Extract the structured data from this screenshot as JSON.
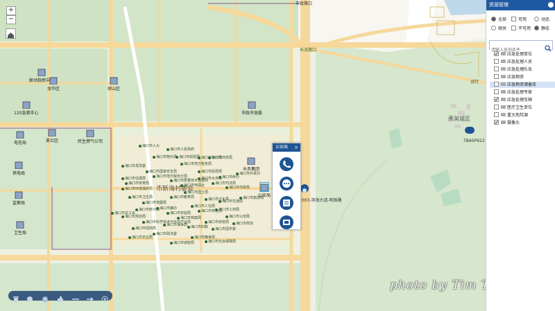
{
  "map": {
    "zoom_in": "+",
    "zoom_out": "−",
    "top_label": "市政路口",
    "road_label_top": "长流路口",
    "popup": {
      "title": "公安局",
      "close": "×",
      "actions": [
        "phone-icon",
        "chat-icon",
        "info-icon",
        "record-icon"
      ]
    },
    "camera_label": "2003-滨海大道-明珠路",
    "top_right_label": "秀英城区",
    "top_right_code": "TBASP622",
    "far_right_label": "沿行",
    "pois": [
      {
        "name": "联动指挥中心"
      },
      {
        "name": "龙华区"
      },
      {
        "name": "琼山区"
      },
      {
        "name": "120急救中心"
      },
      {
        "name": "市政市容委"
      },
      {
        "name": "电信局"
      },
      {
        "name": "美兰区"
      },
      {
        "name": "民生燃气公司"
      },
      {
        "name": "供电局"
      },
      {
        "name": "水务集团"
      },
      {
        "name": "公安局"
      },
      {
        "name": "监察局"
      },
      {
        "name": "卫生局"
      }
    ],
    "district_label": "市新海村委会",
    "gov_labels": [
      "海口市人大",
      "海口市人民政府",
      "海口市物价局",
      "海口市财政局",
      "海口市审计局",
      "海口市商务局",
      "海口市发改委",
      "海口市地方税务局",
      "海口市国家安全局",
      "海口市民政局",
      "海口市地方税务分局",
      "海口市司法局",
      "海口市住建局",
      "海口市质量技术监督局",
      "海口市水务局",
      "海口市电视台",
      "海口市环境保护局",
      "海口市国土局",
      "海口市文化局",
      "海口市市政局",
      "海口市卫生局",
      "海口市地震局",
      "海口市教育局",
      "海口市人社局",
      "海口市交通局",
      "海口市旅游局",
      "海口市统计局",
      "海口市安监局",
      "海口市林业局",
      "海口市工商局",
      "海口市公安局",
      "海口市规划局",
      "海口市科学技术与信息产业局",
      "海口市档案局",
      "海口市房管局",
      "海口市招商局",
      "海口市海事局",
      "海口市妇联",
      "海口市团市委",
      "海口市政协",
      "海口市政法委",
      "海口市粮食局",
      "海口市城管局",
      "海口市社会保障局",
      "海口市总工会",
      "海口市农业局",
      "海口市编办",
      "海口市侨办",
      "海口市外事办",
      "海口市体育局"
    ]
  },
  "toolbar": {
    "tools": [
      "trash-icon",
      "globe-icon",
      "layer-icon",
      "puzzle-icon",
      "line-icon",
      "arrow-icon",
      "target-icon"
    ]
  },
  "panel": {
    "title": "资源管理",
    "filters_row1": [
      "全部",
      "可用",
      "动态"
    ],
    "filters_row2": [
      "相关",
      "不可用",
      "静态"
    ],
    "search_placeholder": "请输入查询条件",
    "list": [
      {
        "label": "应急处理单位",
        "checked": true,
        "selected": false
      },
      {
        "label": "应急处理人员",
        "checked": false,
        "selected": false
      },
      {
        "label": "应急处理队伍",
        "checked": false,
        "selected": false
      },
      {
        "label": "应急物资",
        "checked": false,
        "selected": false
      },
      {
        "label": "应急物资储备库",
        "checked": false,
        "selected": true
      },
      {
        "label": "应急处理专家",
        "checked": false,
        "selected": false
      },
      {
        "label": "应急处理车辆",
        "checked": true,
        "selected": false
      },
      {
        "label": "医疗卫生单位",
        "checked": false,
        "selected": false
      },
      {
        "label": "重大危险源",
        "checked": false,
        "selected": false
      },
      {
        "label": "摄像头",
        "checked": true,
        "selected": false
      }
    ]
  },
  "watermark": "photo  by  Tim  Tsung"
}
